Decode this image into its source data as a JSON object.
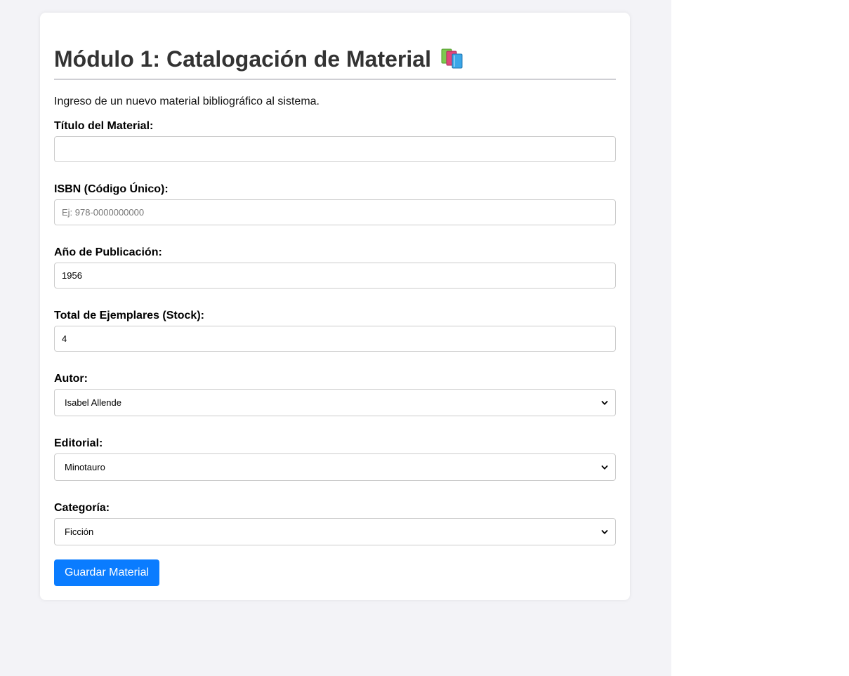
{
  "header": {
    "title": "Módulo 1: Catalogación de Material",
    "title_icon": "books-icon",
    "intro": "Ingreso de un nuevo material bibliográfico al sistema."
  },
  "form": {
    "titulo": {
      "label": "Título del Material:",
      "value": "",
      "placeholder": ""
    },
    "isbn": {
      "label": "ISBN (Código Único):",
      "value": "",
      "placeholder": "Ej: 978-0000000000"
    },
    "anio": {
      "label": "Año de Publicación:",
      "value": "1956"
    },
    "stock": {
      "label": "Total de Ejemplares (Stock):",
      "value": "4"
    },
    "autor": {
      "label": "Autor:",
      "selected": "Isabel Allende"
    },
    "editorial": {
      "label": "Editorial:",
      "selected": "Minotauro"
    },
    "categoria": {
      "label": "Categoría:",
      "selected": "Ficción"
    },
    "submit_label": "Guardar Material"
  },
  "colors": {
    "accent": "#0a7cff",
    "page_background": "#f3f3f7",
    "title_text": "#333333"
  }
}
